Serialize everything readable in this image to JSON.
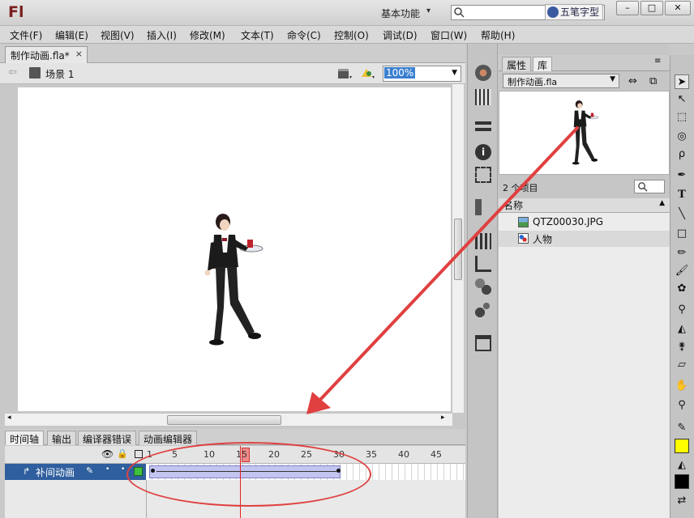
{
  "app": {
    "logo": "Fl",
    "workspace": "基本功能",
    "ime": "五笔字型"
  },
  "window_buttons": [
    "–",
    "□",
    "✕"
  ],
  "menu": [
    "文件(F)",
    "编辑(E)",
    "视图(V)",
    "插入(I)",
    "修改(M)",
    "文本(T)",
    "命令(C)",
    "控制(O)",
    "调试(D)",
    "窗口(W)",
    "帮助(H)"
  ],
  "document": {
    "tab": "制作动画.fla*",
    "close": "×"
  },
  "scene": {
    "label": "场景 1",
    "zoom": "100%"
  },
  "timeline": {
    "tabs": [
      "时间轴",
      "输出",
      "编译器错误",
      "动画编辑器"
    ],
    "frame_numbers": [
      "1",
      "5",
      "10",
      "15",
      "20",
      "25",
      "30",
      "35",
      "40",
      "45"
    ],
    "layer_name": "补间动画",
    "current_frame": 15,
    "tween_start": 1,
    "tween_end": 30
  },
  "library": {
    "tabs": [
      "属性",
      "库"
    ],
    "file": "制作动画.fla",
    "count": "2 个项目",
    "column_header": "名称",
    "items": [
      {
        "name": "QTZ00030.JPG",
        "icon": "bitmap-icon"
      },
      {
        "name": "人物",
        "icon": "graphic-symbol-icon"
      }
    ]
  },
  "colors": {
    "accent": "#3a7fd0",
    "annotation": "#e04040",
    "fill": "#ffff00",
    "stroke": "#000000"
  }
}
